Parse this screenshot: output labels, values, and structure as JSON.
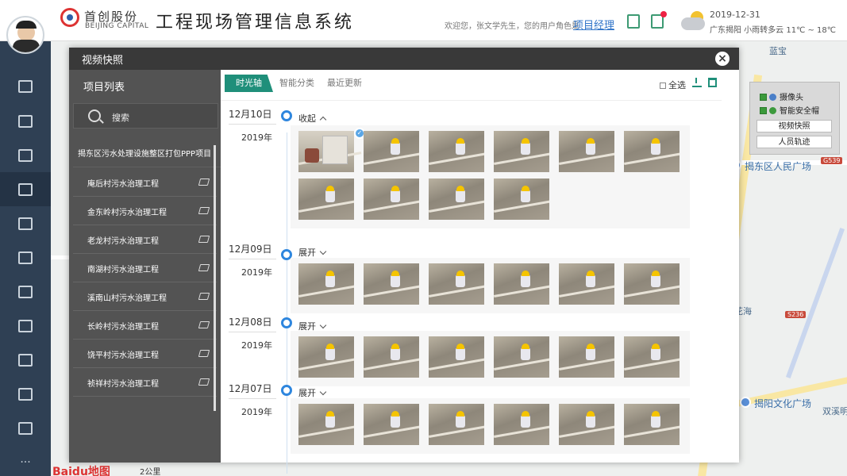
{
  "header": {
    "company_cn": "首创股份",
    "company_en": "BEIJING CAPITAL",
    "system_title": "工程现场管理信息系统",
    "welcome": "欢迎您，张文学先生，您的用户角色是",
    "role": "项目经理",
    "date": "2019-12-31",
    "weather": "广东揭阳  小雨转多云   11℃ ~ 18℃"
  },
  "rail": {
    "items": [
      "monitor-icon",
      "layers-icon",
      "analytics-icon",
      "camera-icon",
      "warning-icon",
      "document-icon",
      "shield-icon",
      "route-icon",
      "report-icon",
      "location-icon",
      "settings-icon",
      "more-icon"
    ],
    "more": "···"
  },
  "modal": {
    "title": "视频快照",
    "close": "×",
    "project_panel": {
      "title": "项目列表",
      "search_label": "搜索",
      "root": "揭东区污水处理设施整区打包PPP项目",
      "items": [
        "庵后村污水治理工程",
        "金东岭村污水治理工程",
        "老龙村污水治理工程",
        "南湖村污水治理工程",
        "溪南山村污水治理工程",
        "长岭村污水治理工程",
        "饶平村污水治理工程",
        "祯祥村污水治理工程"
      ]
    },
    "tabs": [
      "时光轴",
      "智能分类",
      "最近更新"
    ],
    "select_all": "全选",
    "timeline": [
      {
        "date": "12月10日",
        "year": "2019年",
        "toggle": "收起",
        "expanded": true,
        "photos": 10
      },
      {
        "date": "12月09日",
        "year": "2019年",
        "toggle": "展开",
        "expanded": false,
        "photos": 6
      },
      {
        "date": "12月08日",
        "year": "2019年",
        "toggle": "展开",
        "expanded": false,
        "photos": 6
      },
      {
        "date": "12月07日",
        "year": "2019年",
        "toggle": "展开",
        "expanded": false,
        "photos": 6
      }
    ]
  },
  "layers_panel": {
    "camera": "摄像头",
    "helmet": "智能安全帽",
    "btn_snapshot": "视频快照",
    "btn_track": "人员轨迹"
  },
  "map": {
    "labels": [
      "揭东区人民广场",
      "揭阳文化广场",
      "双溪明",
      "港花海",
      "蓝宝"
    ],
    "shield_a": "G539",
    "shield_b": "S236",
    "scale": "2公里",
    "brand": "Baidu地图"
  },
  "colors": {
    "accent": "#1f8f7a",
    "rail": "#2f4054",
    "timeline": "#2e86de",
    "modal_header": "#393939"
  }
}
